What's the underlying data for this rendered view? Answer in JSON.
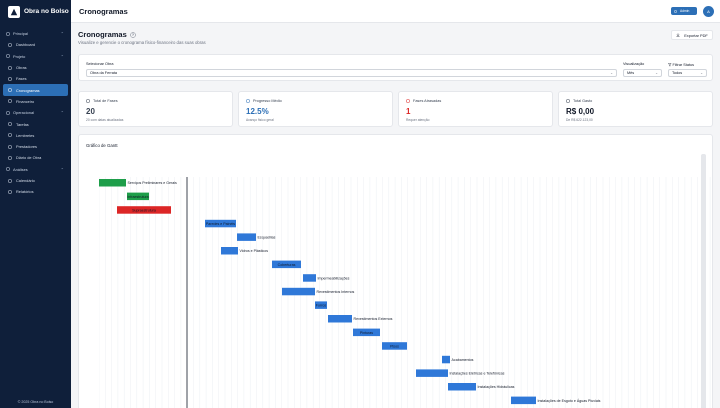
{
  "app": {
    "name": "Obra no Bolso"
  },
  "topbar": {
    "title": "Cronogramas",
    "admin_label": "Admin",
    "avatar_initial": "A"
  },
  "sidebar": {
    "sections": [
      {
        "label": "Principal",
        "items": [
          {
            "label": "Dashboard",
            "icon": "dashboard-icon"
          }
        ]
      },
      {
        "label": "Projeto",
        "items": [
          {
            "label": "Obras",
            "icon": "building-icon"
          },
          {
            "label": "Fases",
            "icon": "layers-icon"
          },
          {
            "label": "Cronogramas",
            "icon": "calendar-icon",
            "active": true
          },
          {
            "label": "Financeiro",
            "icon": "dollar-icon"
          }
        ]
      },
      {
        "label": "Operacional",
        "items": [
          {
            "label": "Tarefas",
            "icon": "checklist-icon"
          },
          {
            "label": "Lembretes",
            "icon": "bell-icon"
          },
          {
            "label": "Prestadores",
            "icon": "users-icon"
          },
          {
            "label": "Diário de Obra",
            "icon": "book-icon"
          }
        ]
      },
      {
        "label": "Análises",
        "items": [
          {
            "label": "Calendário",
            "icon": "calendar-icon"
          },
          {
            "label": "Relatórios",
            "icon": "report-icon"
          }
        ]
      }
    ],
    "footer": "© 2025 Obra no Bolso"
  },
  "page": {
    "title": "Cronogramas",
    "subtitle": "Visualize e gerencie o cronograma físico-financeiro das suas obras",
    "export_label": "Exportar PDF"
  },
  "filters": {
    "obra_label": "Selecionar Obra",
    "obra_value": "Obra da Ferrata",
    "view_label": "Visualização",
    "view_value": "Mês",
    "status_label": "Filtrar Status",
    "status_value": "Todos"
  },
  "stats": [
    {
      "title": "Total de Fases",
      "value": "20",
      "sub": "20 com datas atualizadas",
      "color": "#374151",
      "icon": "flag-icon"
    },
    {
      "title": "Progresso Médio",
      "value": "12.5%",
      "sub": "Avanço físico geral",
      "color": "#2c6fb6",
      "icon": "trend-icon"
    },
    {
      "title": "Fases Atrasadas",
      "value": "1",
      "sub": "Requer atenção",
      "color": "#dc2626",
      "icon": "calendar-alert-icon"
    },
    {
      "title": "Total Gasto",
      "value": "R$ 0,00",
      "sub": "De R$ 622.123,00",
      "color": "#111827",
      "icon": "dollar-icon"
    }
  ],
  "gantt": {
    "title": "Gráfico de Gantt",
    "colors": {
      "done": "#1e9e4a",
      "late": "#dc2626",
      "planned": "#2f78d8"
    },
    "tasks": [
      {
        "label": "Serviços Preliminares e Gerais",
        "start": 0,
        "end": 27,
        "status": "done",
        "label_inside": false
      },
      {
        "label": "Infraestrutura",
        "start": 28,
        "end": 50,
        "status": "done",
        "label_inside": true
      },
      {
        "label": "Supraestrutura",
        "start": 18,
        "end": 72,
        "status": "late",
        "label_inside": true
      },
      {
        "label": "Paredes e Painéis",
        "start": 106,
        "end": 137,
        "status": "planned",
        "label_inside": true
      },
      {
        "label": "Esquadrias",
        "start": 138,
        "end": 157,
        "status": "planned",
        "label_inside": false
      },
      {
        "label": "Vidros e Plásticos",
        "start": 122,
        "end": 139,
        "status": "planned",
        "label_inside": false
      },
      {
        "label": "Coberturas",
        "start": 173,
        "end": 202,
        "status": "planned",
        "label_inside": true
      },
      {
        "label": "Impermeabilizações",
        "start": 204,
        "end": 217,
        "status": "planned",
        "label_inside": false
      },
      {
        "label": "Revestimentos Internos",
        "start": 183,
        "end": 216,
        "status": "planned",
        "label_inside": false
      },
      {
        "label": "Forros",
        "start": 216,
        "end": 228,
        "status": "planned",
        "label_inside": true
      },
      {
        "label": "Revestimentos Externos",
        "start": 229,
        "end": 253,
        "status": "planned",
        "label_inside": false
      },
      {
        "label": "Pinturas",
        "start": 254,
        "end": 281,
        "status": "planned",
        "label_inside": true
      },
      {
        "label": "Pisos",
        "start": 283,
        "end": 308,
        "status": "planned",
        "label_inside": true
      },
      {
        "label": "Acabamentos",
        "start": 343,
        "end": 351,
        "status": "planned",
        "label_inside": false
      },
      {
        "label": "Instalações Elétricas e Telefônicas",
        "start": 317,
        "end": 349,
        "status": "planned",
        "label_inside": false
      },
      {
        "label": "Instalações Hidráulicas",
        "start": 349,
        "end": 377,
        "status": "planned",
        "label_inside": false
      },
      {
        "label": "Instalações de Esgoto e Águas Pluviais",
        "start": 412,
        "end": 437,
        "status": "planned",
        "label_inside": false
      }
    ]
  }
}
